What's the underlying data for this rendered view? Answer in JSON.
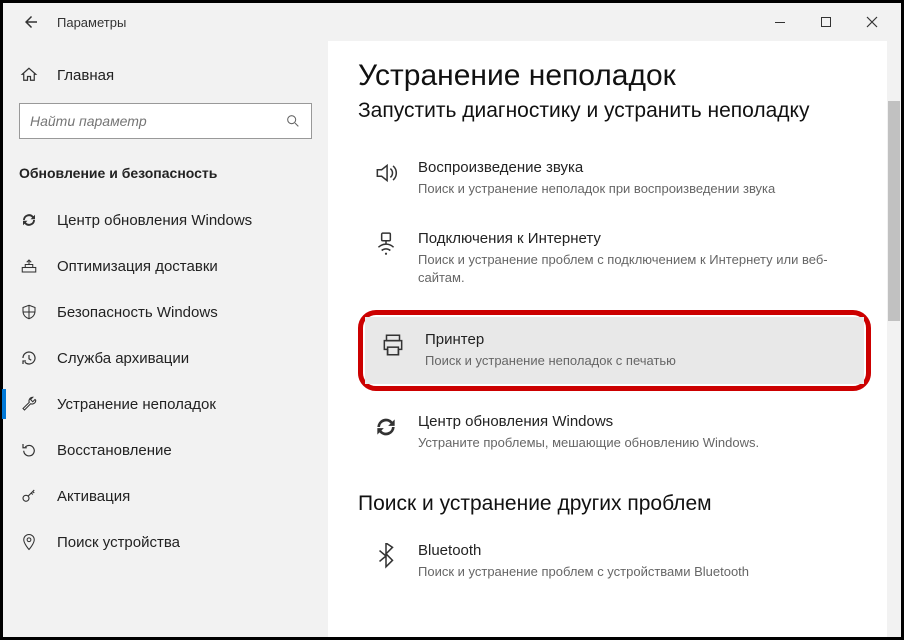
{
  "window": {
    "title": "Параметры"
  },
  "sidebar": {
    "home": "Главная",
    "search_placeholder": "Найти параметр",
    "section": "Обновление и безопасность",
    "items": [
      {
        "label": "Центр обновления Windows"
      },
      {
        "label": "Оптимизация доставки"
      },
      {
        "label": "Безопасность Windows"
      },
      {
        "label": "Служба архивации"
      },
      {
        "label": "Устранение неполадок"
      },
      {
        "label": "Восстановление"
      },
      {
        "label": "Активация"
      },
      {
        "label": "Поиск устройства"
      }
    ]
  },
  "main": {
    "title": "Устранение неполадок",
    "subtitle": "Запустить диагностику и устранить неполадку",
    "items": [
      {
        "title": "Воспроизведение звука",
        "desc": "Поиск и устранение неполадок при воспроизведении звука"
      },
      {
        "title": "Подключения к Интернету",
        "desc": "Поиск и устранение проблем с подключением к Интернету или веб-сайтам."
      },
      {
        "title": "Принтер",
        "desc": "Поиск и устранение неполадок с печатью"
      },
      {
        "title": "Центр обновления Windows",
        "desc": "Устраните проблемы, мешающие обновлению Windows."
      }
    ],
    "section2": "Поиск и устранение других проблем",
    "items2": [
      {
        "title": "Bluetooth",
        "desc": "Поиск и устранение проблем с устройствами Bluetooth"
      }
    ]
  }
}
